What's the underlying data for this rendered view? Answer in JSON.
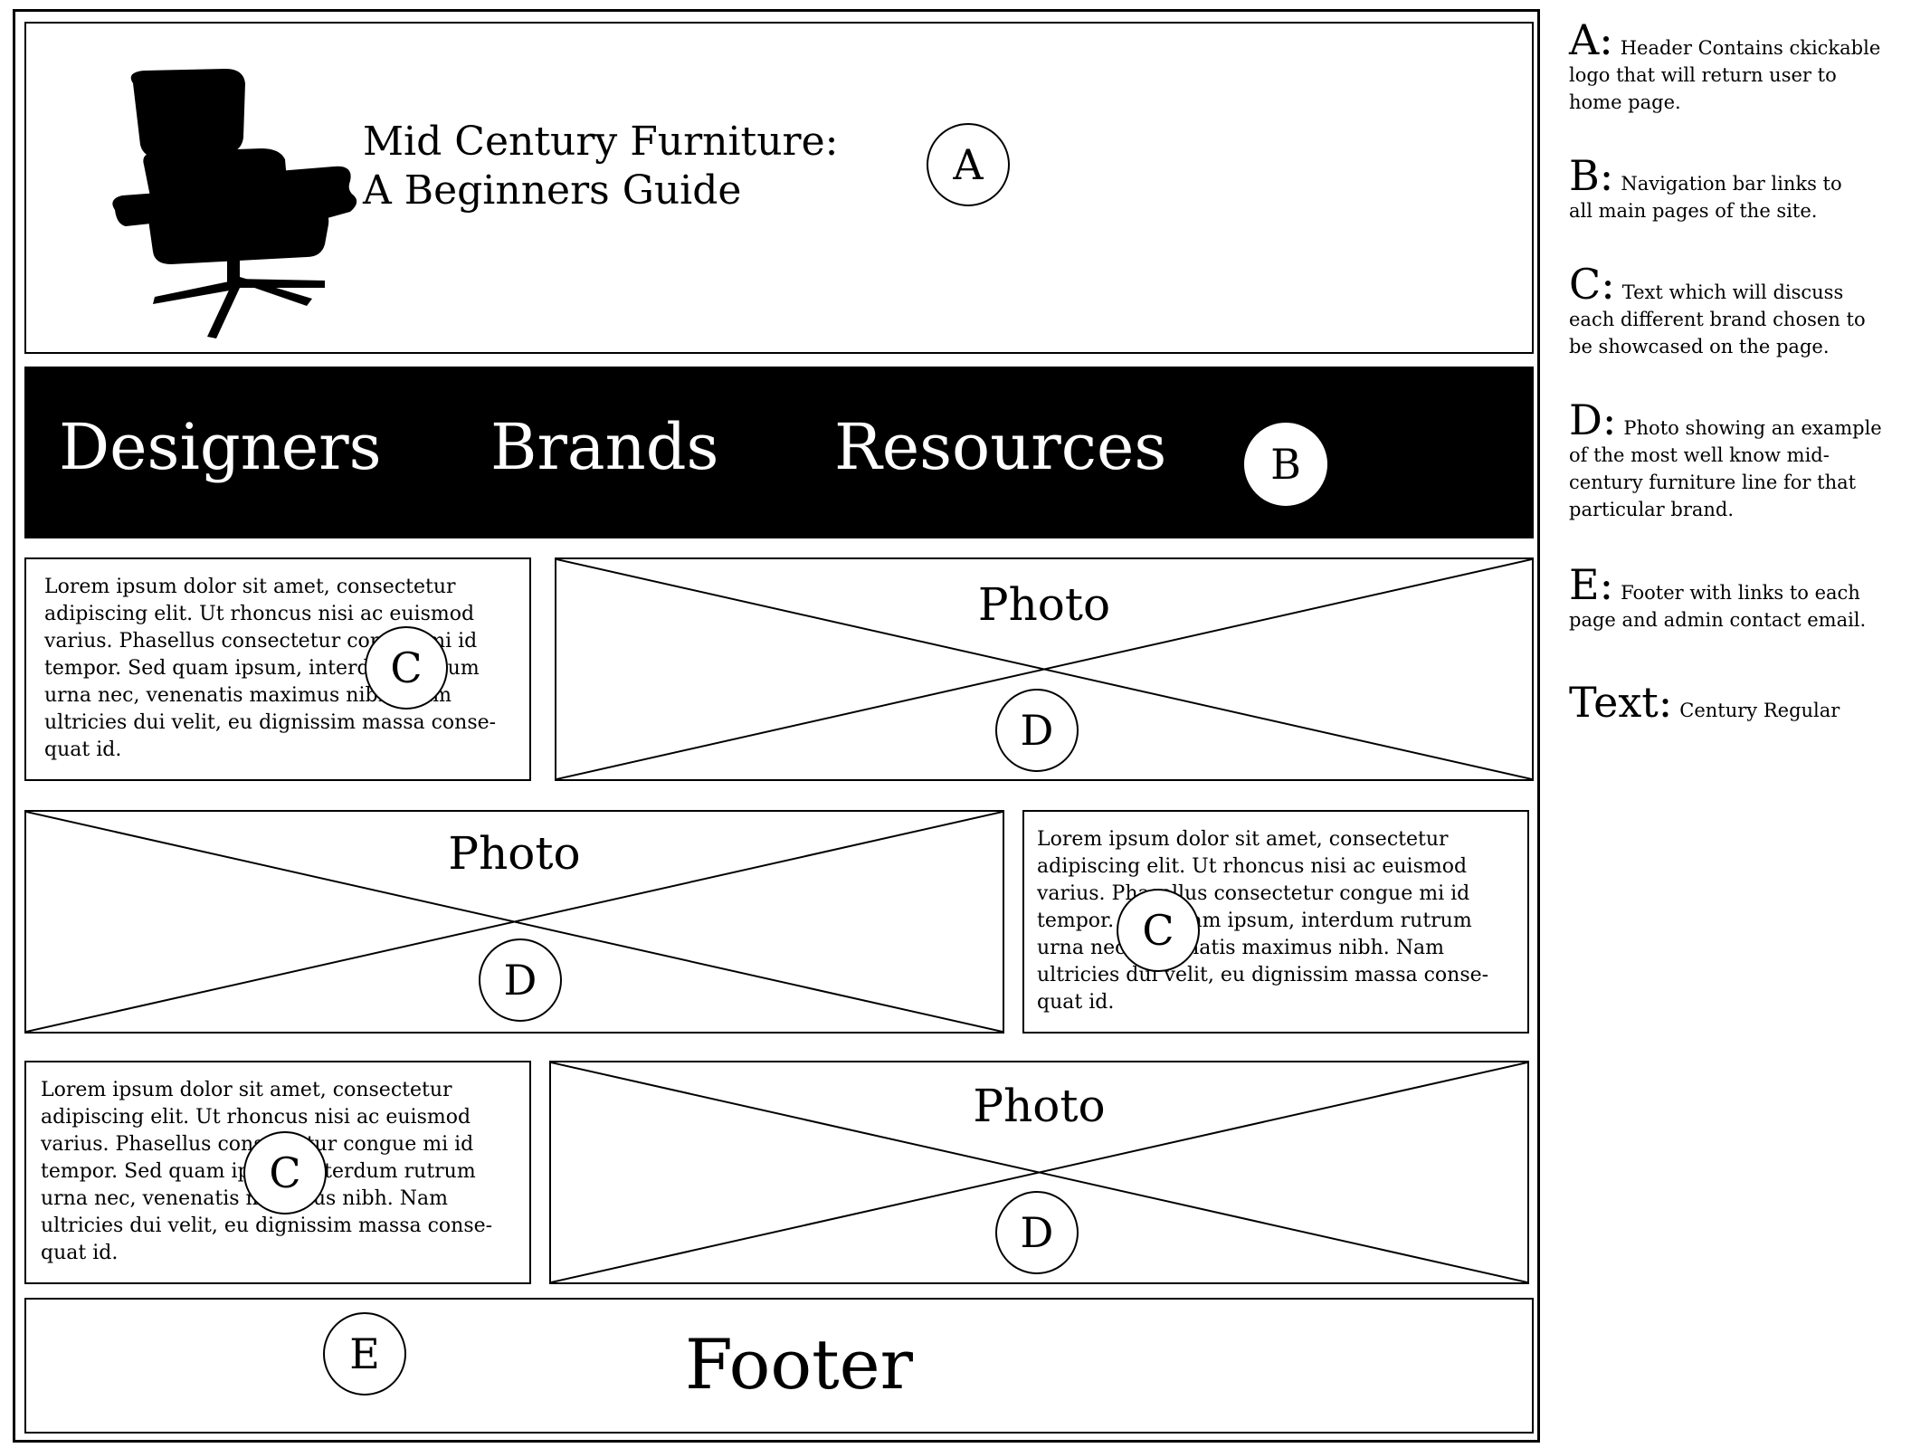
{
  "header": {
    "title_line1": "Mid Century Furniture:",
    "title_line2": "A Beginners Guide",
    "logo_icon": "lounge-chair-icon",
    "marker": "A"
  },
  "nav": {
    "items": [
      "Designers",
      "Brands",
      "Resources"
    ],
    "marker": "B"
  },
  "sections": [
    {
      "text_lines": [
        "Lorem ipsum dolor sit amet, consectetur",
        "adipiscing elit. Ut rhoncus nisi ac euismod",
        "varius. Phasellus consectetur congue mi id",
        "tempor. Sed quam ipsum, interdum rutrum",
        "urna nec, venenatis maximus nibh. Nam",
        "ultricies dui velit, eu dignissim massa conse-",
        "quat id."
      ],
      "text_marker": "C",
      "photo_label": "Photo",
      "photo_marker": "D"
    },
    {
      "text_lines": [
        "Lorem ipsum dolor sit amet, consectetur",
        "adipiscing elit. Ut rhoncus nisi ac euismod",
        "varius. Phasellus consectetur congue mi id",
        "tempor. Sed quam ipsum, interdum rutrum",
        "urna nec, venenatis maximus nibh. Nam",
        "ultricies dui velit, eu dignissim massa conse-",
        "quat id."
      ],
      "text_marker": "C",
      "photo_label": "Photo",
      "photo_marker": "D"
    },
    {
      "text_lines": [
        "Lorem ipsum dolor sit amet, consectetur",
        "adipiscing elit. Ut rhoncus nisi ac euismod",
        "varius. Phasellus consectetur congue mi id",
        "tempor. Sed quam ipsum, interdum rutrum",
        "urna nec, venenatis maximus nibh. Nam",
        "ultricies dui velit, eu dignissim massa conse-",
        "quat id."
      ],
      "text_marker": "C",
      "photo_label": "Photo",
      "photo_marker": "D"
    }
  ],
  "footer": {
    "label": "Footer",
    "marker": "E"
  },
  "legend": [
    {
      "key": "A:",
      "lines": [
        "Header Contains ckickable",
        "logo that will return user to",
        "home page."
      ]
    },
    {
      "key": "B:",
      "lines": [
        "Navigation bar links to",
        "all main pages of the site."
      ]
    },
    {
      "key": "C:",
      "lines": [
        "Text which will discuss",
        "each different brand chosen to",
        "be showcased on the page."
      ]
    },
    {
      "key": "D:",
      "lines": [
        "Photo showing an example",
        "of the most well know mid-",
        "century furniture line for that",
        "particular brand."
      ]
    },
    {
      "key": "E:",
      "lines": [
        "Footer with links to each",
        "page and admin contact email."
      ]
    },
    {
      "key": "Text:",
      "lines": [
        "Century Regular"
      ]
    }
  ]
}
